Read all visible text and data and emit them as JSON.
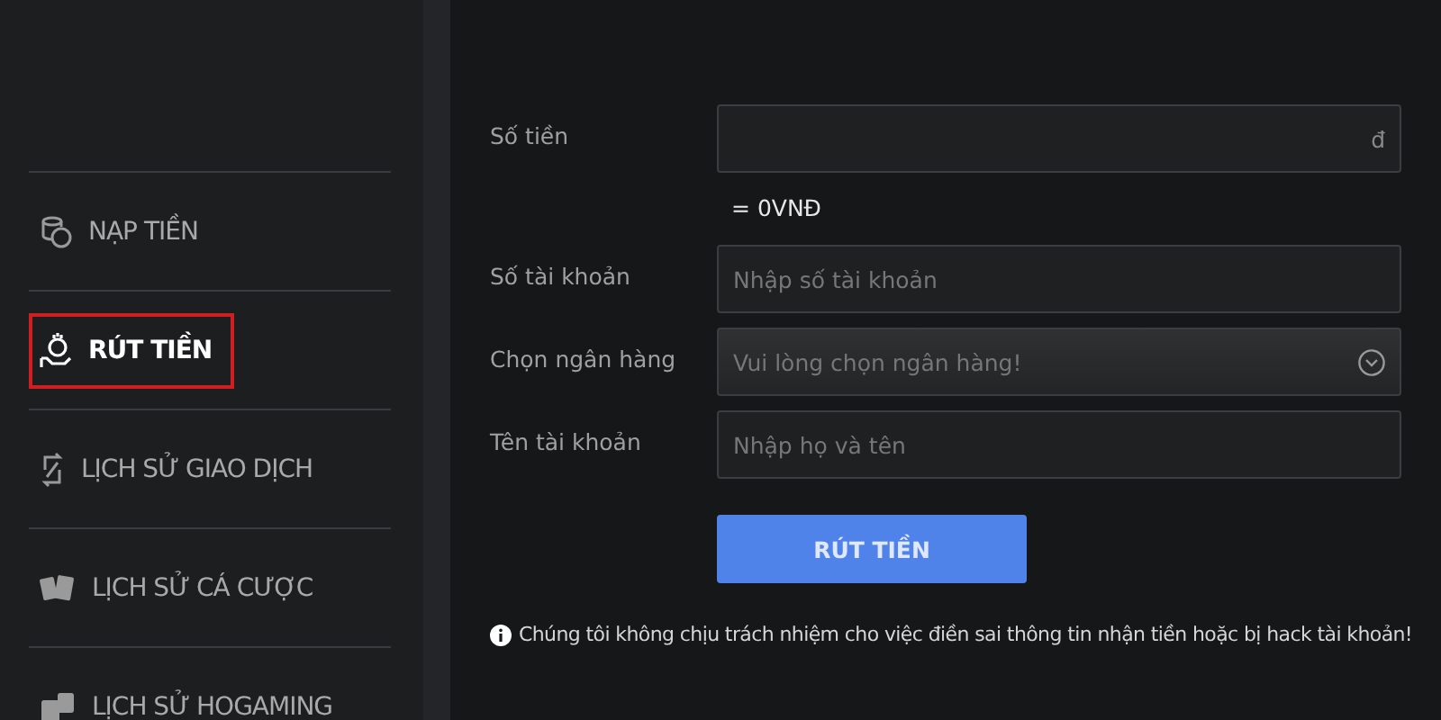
{
  "sidebar": {
    "items": [
      {
        "label": "NẠP TIỀN",
        "selected": false
      },
      {
        "label": "RÚT TIỀN",
        "selected": true
      },
      {
        "label": "LỊCH SỬ GIAO DỊCH",
        "selected": false
      },
      {
        "label": "LỊCH SỬ CÁ CƯỢC",
        "selected": false
      },
      {
        "label": "LỊCH SỬ HOGAMING",
        "selected": false
      }
    ]
  },
  "form": {
    "rows": [
      {
        "kind": "input",
        "label": "Số tiền",
        "suffix": "đ",
        "note": "= 0VNĐ"
      },
      {
        "kind": "input",
        "label": "Số tài khoản",
        "placeholder": "Nhập số tài khoản"
      },
      {
        "kind": "select",
        "label": "Chọn ngân hàng",
        "placeholder": "Vui lòng chọn ngân hàng!"
      },
      {
        "kind": "input",
        "label": "Tên tài khoản",
        "placeholder": "Nhập họ và tên"
      }
    ],
    "submit": "RÚT TIỀN",
    "disclaimer": "Chúng tôi không chịu trách nhiệm cho việc điền sai thông tin nhận tiền hoặc bị hack tài khoản!"
  }
}
